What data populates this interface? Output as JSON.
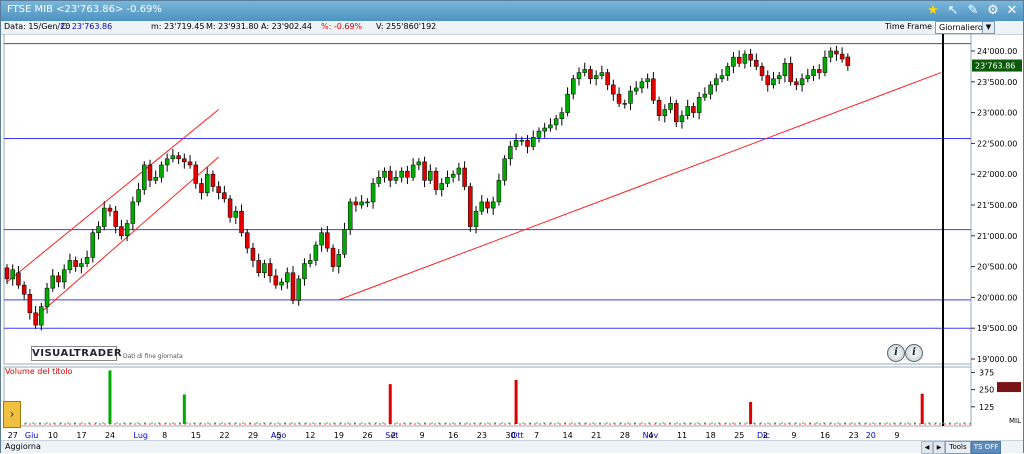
{
  "window": {
    "title": "FTSE MIB <23'763.86> -0.69%"
  },
  "infobar": {
    "date": "Data: 15/Gen/20",
    "close": "C: 23'763.86",
    "min": "m: 23'719.45",
    "max": "M: 23'931.80",
    "open": "A: 23'902.44",
    "pct": "%: -0.69%",
    "volume": "V: 255'860'192",
    "timeframe_label": "Time Frame",
    "timeframe_value": "Giornaliero"
  },
  "colors": {
    "up": "#00aa00",
    "down": "#e00000",
    "hline": "#3b3bff",
    "trend": "#ff2020",
    "last_price_bg": "#0a5a0a"
  },
  "logo": {
    "name": "VISUALTRADER",
    "subtitle": "Dati di fine giornata"
  },
  "volume_panel": {
    "title": "Volume del titolo",
    "unit": "MIL",
    "tick_labels": [
      "375",
      "250",
      "125"
    ]
  },
  "bottombar": {
    "update": "Aggiorna",
    "tools": "Tools",
    "ts_off": "TS OFF"
  },
  "chart_data": {
    "type": "candlestick",
    "title": "FTSE MIB",
    "last_price": "23'763.86",
    "y_range": [
      19000,
      24200
    ],
    "y_tick_labels": [
      "24'000.00",
      "23'500.00",
      "23'000.00",
      "22'500.00",
      "22'000.00",
      "21'500.00",
      "21'000.00",
      "20'500.00",
      "20'000.00",
      "19'500.00",
      "19'000.00"
    ],
    "y_tick_values": [
      24000,
      23500,
      23000,
      22500,
      22000,
      21500,
      21000,
      20500,
      20000,
      19500,
      19000
    ],
    "horizontal_lines": [
      22580,
      21100,
      19960,
      19500
    ],
    "x_labels": [
      {
        "label": "27",
        "i": 1,
        "month": false
      },
      {
        "label": "Giu",
        "i": 4,
        "month": true
      },
      {
        "label": "10",
        "i": 8,
        "month": false
      },
      {
        "label": "17",
        "i": 13,
        "month": false
      },
      {
        "label": "24",
        "i": 18,
        "month": false
      },
      {
        "label": "Lug",
        "i": 23,
        "month": true
      },
      {
        "label": "8",
        "i": 28,
        "month": false
      },
      {
        "label": "15",
        "i": 33,
        "month": false
      },
      {
        "label": "22",
        "i": 38,
        "month": false
      },
      {
        "label": "29",
        "i": 43,
        "month": false
      },
      {
        "label": "Ago",
        "i": 47,
        "month": true
      },
      {
        "label": "5",
        "i": 48,
        "month": false
      },
      {
        "label": "12",
        "i": 53,
        "month": false
      },
      {
        "label": "19",
        "i": 58,
        "month": false
      },
      {
        "label": "26",
        "i": 63,
        "month": false
      },
      {
        "label": "Set",
        "i": 67,
        "month": true
      },
      {
        "label": "2",
        "i": 68,
        "month": false
      },
      {
        "label": "9",
        "i": 73,
        "month": false
      },
      {
        "label": "16",
        "i": 78,
        "month": false
      },
      {
        "label": "23",
        "i": 83,
        "month": false
      },
      {
        "label": "30",
        "i": 88,
        "month": false
      },
      {
        "label": "Ott",
        "i": 89,
        "month": true
      },
      {
        "label": "7",
        "i": 93,
        "month": false
      },
      {
        "label": "14",
        "i": 98,
        "month": false
      },
      {
        "label": "21",
        "i": 103,
        "month": false
      },
      {
        "label": "28",
        "i": 108,
        "month": false
      },
      {
        "label": "Nov",
        "i": 112,
        "month": true
      },
      {
        "label": "4",
        "i": 113,
        "month": false
      },
      {
        "label": "11",
        "i": 118,
        "month": false
      },
      {
        "label": "18",
        "i": 123,
        "month": false
      },
      {
        "label": "25",
        "i": 128,
        "month": false
      },
      {
        "label": "Dic",
        "i": 132,
        "month": true
      },
      {
        "label": "2",
        "i": 133,
        "month": false
      },
      {
        "label": "9",
        "i": 138,
        "month": false
      },
      {
        "label": "16",
        "i": 143,
        "month": false
      },
      {
        "label": "23",
        "i": 148,
        "month": false
      },
      {
        "label": "20",
        "i": 151,
        "month": true
      },
      {
        "label": "9",
        "i": 156,
        "month": false
      }
    ],
    "closes": [
      20300,
      20450,
      20200,
      20050,
      19750,
      19550,
      19850,
      20150,
      20350,
      20250,
      20450,
      20600,
      20500,
      20550,
      20650,
      21050,
      21150,
      21450,
      21400,
      21150,
      21000,
      21200,
      21550,
      21750,
      22150,
      21900,
      21950,
      22150,
      22250,
      22300,
      22250,
      22200,
      22150,
      21850,
      21700,
      22000,
      21800,
      21700,
      21600,
      21300,
      21400,
      21050,
      20800,
      20600,
      20400,
      20550,
      20350,
      20200,
      20250,
      20400,
      19950,
      20300,
      20550,
      20600,
      20850,
      21050,
      20800,
      20500,
      20700,
      21100,
      21550,
      21500,
      21550,
      21550,
      21850,
      21950,
      22050,
      21900,
      21950,
      22050,
      21950,
      22150,
      22200,
      21900,
      22050,
      21750,
      21850,
      21950,
      22000,
      22100,
      21800,
      21150,
      21400,
      21550,
      21450,
      21550,
      21900,
      22250,
      22450,
      22550,
      22550,
      22450,
      22600,
      22700,
      22750,
      22800,
      22900,
      23000,
      23300,
      23550,
      23650,
      23700,
      23550,
      23600,
      23650,
      23450,
      23300,
      23150,
      23150,
      23350,
      23400,
      23500,
      23550,
      23200,
      22950,
      23050,
      23150,
      22850,
      22950,
      23100,
      23000,
      23250,
      23300,
      23450,
      23550,
      23600,
      23750,
      23900,
      23800,
      23950,
      23850,
      23750,
      23600,
      23450,
      23550,
      23600,
      23800,
      23500,
      23450,
      23550,
      23600,
      23700,
      23650,
      23900,
      24000,
      23950,
      23870,
      23763
    ],
    "opens_delta": [
      -180,
      150,
      -200,
      -150,
      -300,
      -200,
      300,
      300,
      200,
      -100,
      200,
      150,
      -100,
      50,
      100,
      400,
      100,
      300,
      -50,
      -250,
      -150,
      200,
      350,
      200,
      400,
      -250,
      50,
      200,
      100,
      50,
      -50,
      -50,
      -50,
      -300,
      -150,
      300,
      -200,
      -100,
      -100,
      -300,
      100,
      -350,
      -250,
      -200,
      -200,
      150,
      -200,
      -150,
      50,
      150,
      -450,
      350,
      250,
      50,
      250,
      200,
      -250,
      -300,
      200,
      400,
      450,
      -50,
      50,
      0,
      300,
      100,
      100,
      -150,
      50,
      100,
      -100,
      200,
      50,
      -300,
      150,
      -300,
      100,
      100,
      50,
      100,
      -300,
      -650,
      250,
      150,
      -100,
      100,
      350,
      350,
      200,
      100,
      0,
      -100,
      150,
      100,
      50,
      50,
      100,
      100,
      300,
      250,
      100,
      50,
      -150,
      50,
      50,
      -200,
      -150,
      -150,
      0,
      200,
      50,
      100,
      50,
      -350,
      -250,
      100,
      100,
      -300,
      100,
      150,
      -100,
      250,
      50,
      150,
      100,
      50,
      150,
      150,
      -100,
      150,
      -100,
      -100,
      -150,
      -150,
      100,
      50,
      200,
      -300,
      -50,
      100,
      50,
      100,
      -50,
      250,
      100,
      -50,
      -80,
      -140
    ],
    "volume_spikes": [
      {
        "i": 18,
        "value": 390
      },
      {
        "i": 31,
        "value": 215
      },
      {
        "i": 67,
        "value": 290
      },
      {
        "i": 89,
        "value": 320
      },
      {
        "i": 130,
        "value": 160
      },
      {
        "i": 160,
        "value": 220
      }
    ]
  }
}
